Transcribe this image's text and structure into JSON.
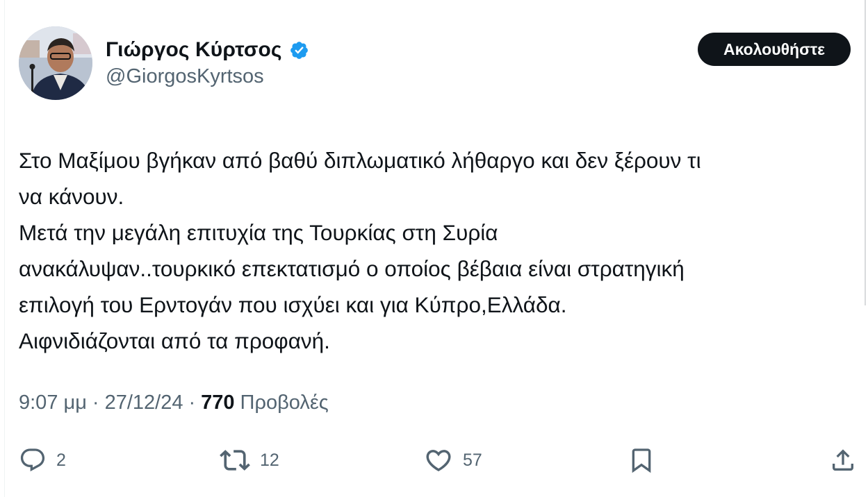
{
  "author": {
    "display_name": "Γιώργος Κύρτσος",
    "handle": "@GiorgosKyrtsos",
    "verified": true,
    "verified_color": "#1d9bf0"
  },
  "follow_button": {
    "label": "Ακολουθήστε"
  },
  "tweet": {
    "lines": [
      "Στο Μαξίμου βγήκαν από βαθύ διπλωματικό λήθαργο και δεν ξέρουν τι",
      "να κάνουν.",
      "Μετά την μεγάλη επιτυχία της Τουρκίας στη Συρία",
      "ανακάλυψαν..τουρκικό επεκτατισμό ο οποίος βέβαια είναι στρατηγική",
      "επιλογή του Ερντογάν που ισχύει και για Κύπρο,Ελλάδα.",
      "Αιφνιδιάζονται από τα προφανή."
    ]
  },
  "meta": {
    "time": "9:07 μμ",
    "separator": "·",
    "date": "27/12/24",
    "views_count": "770",
    "views_label": "Προβολές"
  },
  "actions": {
    "reply": {
      "icon": "reply-icon",
      "count": "2"
    },
    "retweet": {
      "icon": "retweet-icon",
      "count": "12"
    },
    "like": {
      "icon": "heart-icon",
      "count": "57"
    },
    "bookmark": {
      "icon": "bookmark-icon"
    },
    "share": {
      "icon": "share-icon"
    }
  },
  "colors": {
    "text": "#0f1419",
    "secondary": "#536471",
    "button_bg": "#0f1419",
    "button_text": "#ffffff"
  }
}
